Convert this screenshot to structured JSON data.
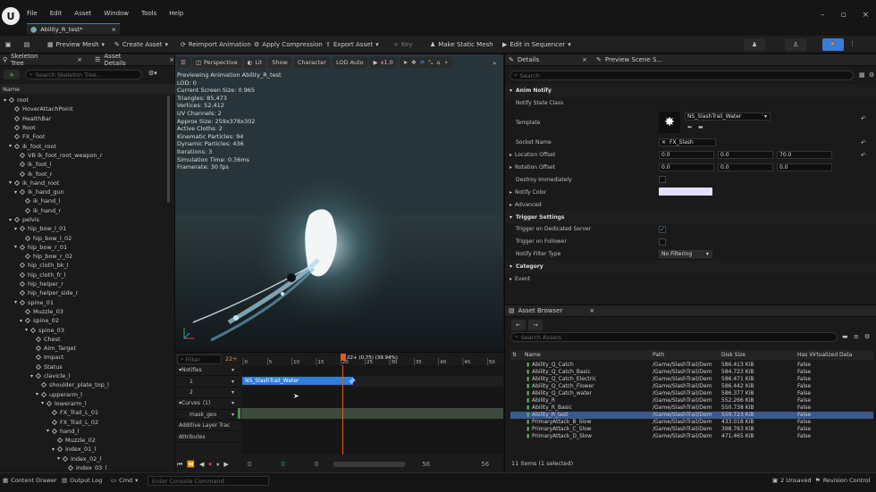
{
  "menu": [
    "File",
    "Edit",
    "Asset",
    "Window",
    "Tools",
    "Help"
  ],
  "doc_tab": "Ability_R_test*",
  "toolbar": {
    "preview_mesh": "Preview Mesh",
    "create_asset": "Create Asset",
    "reimport": "Reimport Animation",
    "apply_compression": "Apply Compression",
    "export_asset": "Export Asset",
    "key": "Key",
    "make_static_mesh": "Make Static Mesh",
    "edit_sequencer": "Edit in Sequencer"
  },
  "left": {
    "tab1": "Skeleton Tree",
    "tab2": "Asset Details",
    "search_ph": "Search Skeleton Tree...",
    "name_header": "Name",
    "bones": [
      {
        "n": "root",
        "d": 0
      },
      {
        "n": "HoverAttachPoint",
        "d": 1
      },
      {
        "n": "HealthBar",
        "d": 1
      },
      {
        "n": "Root",
        "d": 1
      },
      {
        "n": "FX_Foot",
        "d": 1
      },
      {
        "n": "ik_foot_root",
        "d": 1
      },
      {
        "n": "VB ik_foot_root_weapon_r",
        "d": 2
      },
      {
        "n": "ik_foot_l",
        "d": 2
      },
      {
        "n": "ik_foot_r",
        "d": 2
      },
      {
        "n": "ik_hand_root",
        "d": 1
      },
      {
        "n": "ik_hand_gun",
        "d": 2
      },
      {
        "n": "ik_hand_l",
        "d": 3
      },
      {
        "n": "ik_hand_r",
        "d": 3
      },
      {
        "n": "pelvis",
        "d": 1
      },
      {
        "n": "hip_bow_l_01",
        "d": 2
      },
      {
        "n": "hip_bow_l_02",
        "d": 3
      },
      {
        "n": "hip_bow_r_01",
        "d": 2
      },
      {
        "n": "hip_bow_r_02",
        "d": 3
      },
      {
        "n": "hip_cloth_bk_l",
        "d": 2
      },
      {
        "n": "hip_cloth_fr_l",
        "d": 2
      },
      {
        "n": "hip_helper_r",
        "d": 2
      },
      {
        "n": "hip_helper_side_r",
        "d": 2
      },
      {
        "n": "spine_01",
        "d": 2
      },
      {
        "n": "Muzzle_03",
        "d": 3
      },
      {
        "n": "spine_02",
        "d": 3
      },
      {
        "n": "spine_03",
        "d": 4
      },
      {
        "n": "Chest",
        "d": 5
      },
      {
        "n": "Aim_Target",
        "d": 5
      },
      {
        "n": "Impact",
        "d": 5
      },
      {
        "n": "Status",
        "d": 5
      },
      {
        "n": "clavicle_l",
        "d": 5
      },
      {
        "n": "shoulder_plate_top_l",
        "d": 6
      },
      {
        "n": "upperarm_l",
        "d": 6
      },
      {
        "n": "lowerarm_l",
        "d": 7
      },
      {
        "n": "FX_Trail_L_01",
        "d": 8
      },
      {
        "n": "FX_Trail_L_02",
        "d": 8
      },
      {
        "n": "hand_l",
        "d": 8
      },
      {
        "n": "Muzzle_02",
        "d": 9
      },
      {
        "n": "index_01_l",
        "d": 9
      },
      {
        "n": "index_02_l",
        "d": 10
      },
      {
        "n": "index_03_l",
        "d": 11
      }
    ]
  },
  "viewport": {
    "perspective": "Perspective",
    "lit": "Lit",
    "show": "Show",
    "character": "Character",
    "lod": "LOD Auto",
    "speed": "x1.0",
    "stats": [
      "Previewing Animation Ability_R_test",
      "LOD: 0",
      "Current Screen Size: 0.965",
      "Triangles: 85,473",
      "Vertices: 52,412",
      "UV Channels: 2",
      "Approx Size: 259x378x302",
      "Active Cloths: 2",
      "Kinematic Particles: 94",
      "Dynamic Particles: 436",
      "Iterations: 3",
      "Simulation Time: 0.36ms",
      "Framerate: 30 fps"
    ]
  },
  "timeline": {
    "filter_ph": "Filter",
    "frame": "22+",
    "playhead_label": "22+ (0.75) (39.94%)",
    "ticks": [
      "0",
      "5",
      "10",
      "15",
      "20",
      "25",
      "30",
      "35",
      "40",
      "45",
      "50"
    ],
    "tracks": [
      "Notifies",
      "1",
      "2",
      "Curves",
      "mask_geo",
      "Additive Layer Trac",
      "Attributes"
    ],
    "curves_count": "(1)",
    "notify_label": "NS_SlashTrail_Water",
    "transport_vals": [
      "0",
      "0",
      "0",
      "56",
      "56"
    ]
  },
  "details": {
    "tab": "Details",
    "tab2": "Preview Scene S...",
    "search_ph": "Search",
    "cat_anim_notify": "Anim Notify",
    "notify_state_class": "Notify State Class",
    "template": "Template",
    "template_value": "NS_SlashTrail_Water",
    "socket_name": "Socket Name",
    "socket_value": "FX_Slash",
    "location_offset": "Location Offset",
    "loc": [
      "0.0",
      "0.0",
      "70.0"
    ],
    "rotation_offset": "Rotation Offset",
    "rot": [
      "0.0",
      "0.0",
      "0.0"
    ],
    "destroy_immediately": "Destroy Immediately",
    "notify_color": "Notify Color",
    "notify_color_hex": "#e4e0fb",
    "advanced": "Advanced",
    "cat_trigger": "Trigger Settings",
    "trigger_dedicated": "Trigger on Dedicated Server",
    "trigger_follower": "Trigger on Follower",
    "notify_filter_type": "Notify Filter Type",
    "notify_filter_value": "No Filtering",
    "cat_category": "Category",
    "cat_event": "Event"
  },
  "asset_browser": {
    "tab": "Asset Browser",
    "search_ph": "Search Assets",
    "cols": [
      "Name",
      "Path",
      "Disk Size",
      "Has Virtualized Data"
    ],
    "rows": [
      {
        "name": "Ability_Q_Catch",
        "path": "/Game/SlashTrail/Dem",
        "size": "586.413 KiB",
        "v": "False"
      },
      {
        "name": "Ability_Q_Catch_Basic",
        "path": "/Game/SlashTrail/Dem",
        "size": "584.723 KiB",
        "v": "False"
      },
      {
        "name": "Ability_Q_Catch_Electric",
        "path": "/Game/SlashTrail/Dem",
        "size": "586.471 KiB",
        "v": "False"
      },
      {
        "name": "Ability_Q_Catch_Flower",
        "path": "/Game/SlashTrail/Dem",
        "size": "586.442 KiB",
        "v": "False"
      },
      {
        "name": "Ability_Q_Catch_water",
        "path": "/Game/SlashTrail/Dem",
        "size": "586.377 KiB",
        "v": "False"
      },
      {
        "name": "Ability_R",
        "path": "/Game/SlashTrail/Dem",
        "size": "552.266 KiB",
        "v": "False"
      },
      {
        "name": "Ability_R_Basic",
        "path": "/Game/SlashTrail/Dem",
        "size": "550.738 KiB",
        "v": "False"
      },
      {
        "name": "Ability_R_test",
        "path": "/Game/SlashTrail/Dem",
        "size": "550.723 KiB",
        "v": "False"
      },
      {
        "name": "PrimaryAttack_B_Slow",
        "path": "/Game/SlashTrail/Dem",
        "size": "433.018 KiB",
        "v": "False"
      },
      {
        "name": "PrimaryAttack_C_Slow",
        "path": "/Game/SlashTrail/Dem",
        "size": "398.763 KiB",
        "v": "False"
      },
      {
        "name": "PrimaryAttack_D_Slow",
        "path": "/Game/SlashTrail/Dem",
        "size": "471.465 KiB",
        "v": "False"
      }
    ],
    "count": "11 items (1 selected)"
  },
  "status": {
    "content_drawer": "Content Drawer",
    "output_log": "Output Log",
    "cmd": "Cmd",
    "console_ph": "Enter Console Command",
    "unsaved": "2 Unsaved",
    "revision": "Revision Control"
  },
  "colors": {
    "accent": "#3a7bd5",
    "notify_bar": "#2f7ed8",
    "track_green": "#4f8a4f",
    "playhead": "#e2591e"
  }
}
